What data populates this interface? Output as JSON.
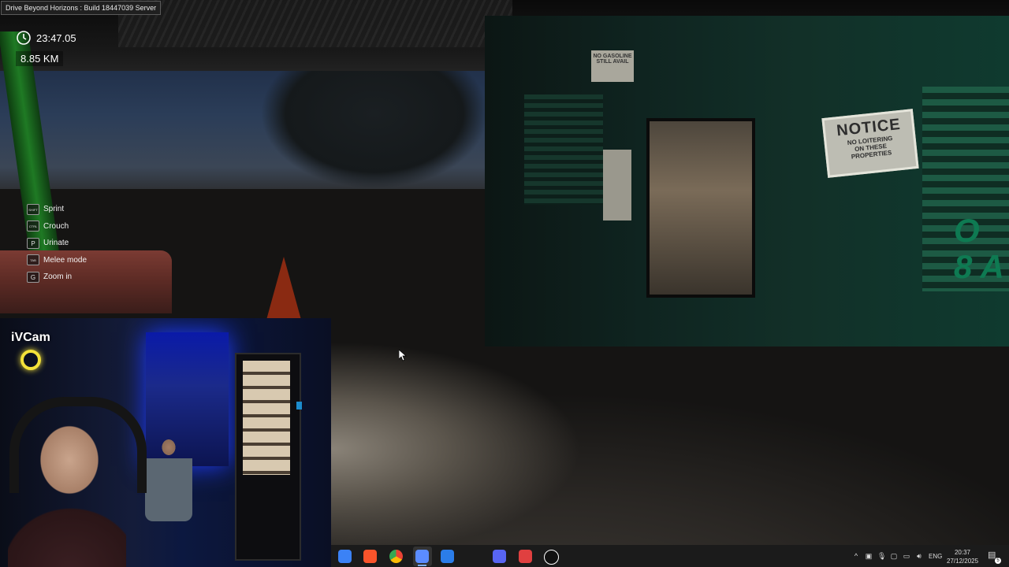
{
  "window": {
    "title": "Drive Beyond Horizons : Build 18447039 Server"
  },
  "hud": {
    "clock_icon": "clock-icon",
    "time": "23:47.05",
    "distance": "8.85 KM",
    "controls": [
      {
        "key": "SHIFT",
        "label": "Sprint"
      },
      {
        "key": "CTRL",
        "label": "Crouch"
      },
      {
        "key": "P",
        "label": "Urinate"
      },
      {
        "key": "TAB",
        "label": "Melee mode"
      },
      {
        "key": "G",
        "label": "Zoom in"
      }
    ]
  },
  "scene": {
    "notice_sign": {
      "title": "NOTICE",
      "line1": "NO LOITERING",
      "line2": "ON THESE",
      "line3": "PROPERTIES"
    },
    "small_sign": {
      "line1": "NO GASOLINE",
      "line2": "STILL AVAIL"
    },
    "store_sign_partial": {
      "line1": "O",
      "line2": "8 A"
    }
  },
  "webcam": {
    "label": "iVCam"
  },
  "taskbar": {
    "apps": [
      {
        "name": "windows-start-icon",
        "color": "#3b82f6"
      },
      {
        "name": "brave-browser-icon",
        "color": "#fb542b"
      },
      {
        "name": "chrome-icon",
        "color": "#34a853"
      },
      {
        "name": "game-app-icon",
        "color": "#5b8cff",
        "active": true
      },
      {
        "name": "edge-icon",
        "color": "#2b7de9"
      },
      {
        "name": "discord-icon",
        "color": "#5865f2"
      },
      {
        "name": "davinci-resolve-icon",
        "color": "#e04040"
      },
      {
        "name": "unreal-engine-icon",
        "color": "#ffffff"
      }
    ],
    "tray": {
      "chevron": "^",
      "language": "ENG",
      "time": "20:37",
      "date": "27/12/2025",
      "notification_count": "5"
    }
  }
}
